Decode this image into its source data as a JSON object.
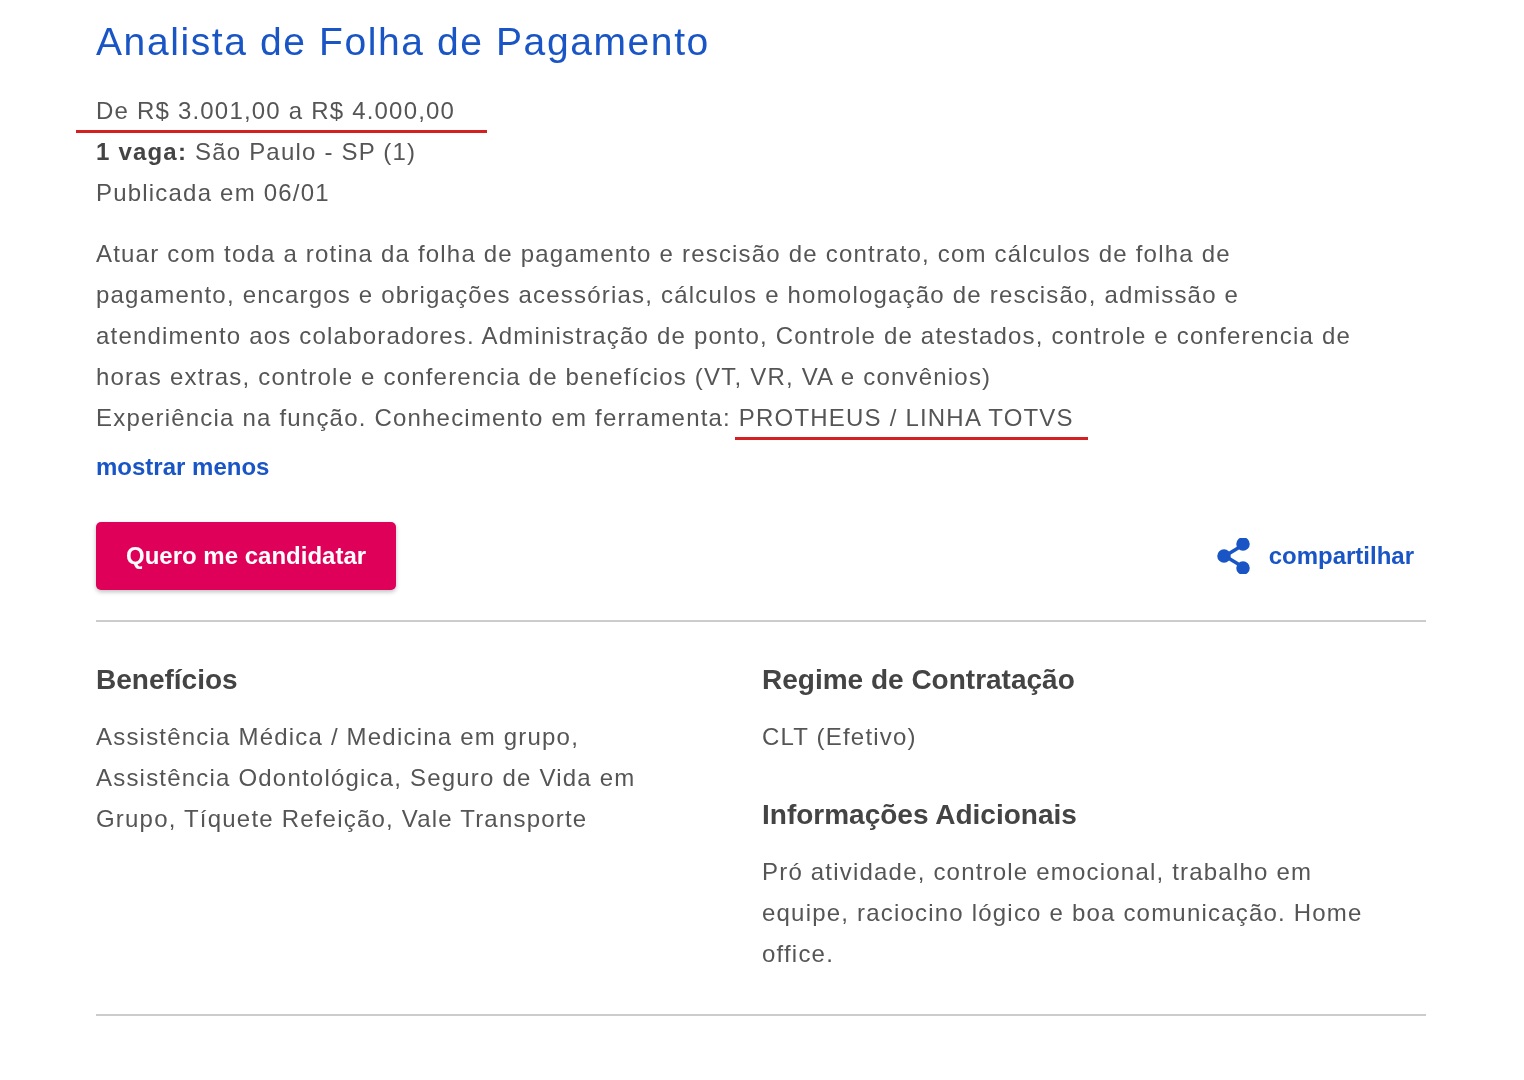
{
  "job": {
    "title": "Analista de Folha de Pagamento",
    "salary": {
      "text": "De R$ 3.001,00 a R$ 4.000,00",
      "underlined": true
    },
    "vacancy": "**1 vaga:** São Paulo - SP (1)",
    "published": "Publicada em 06/01",
    "description_lines": [
      [
        {
          "text": "Atuar com toda a rotina da folha de pagamento e rescisão de contrato, com cálculos de folha de",
          "underlined": false
        }
      ],
      [
        {
          "text": "pagamento, encargos e obrigações acessórias, cálculos e homologação de rescisão, admissão e",
          "underlined": false
        }
      ],
      [
        {
          "text": "atendimento aos colaboradores. Administração de ponto, Controle de atestados, controle e conferencia de",
          "underlined": false
        }
      ],
      [
        {
          "text": "horas extras, controle e conferencia de benefícios (VT, VR, VA e convênios)",
          "underlined": false
        }
      ],
      [
        {
          "text": "Experiência na função. Conhecimento em ferramenta: ",
          "underlined": false
        },
        {
          "text": "PROTHEUS / LINHA TOTVS",
          "underlined": true
        }
      ]
    ],
    "toggle_link": "mostrar menos",
    "apply_button": "Quero me candidatar",
    "share_link": "compartilhar"
  },
  "left_column": [
    {
      "heading": "Benefícios",
      "lines": [
        "Assistência Médica / Medicina em grupo,",
        "Assistência Odontológica, Seguro de Vida em",
        "Grupo, Tíquete Refeição, Vale Transporte"
      ]
    }
  ],
  "right_column": [
    {
      "heading": "Regime de Contratação",
      "lines": [
        "CLT (Efetivo)"
      ]
    },
    {
      "heading": "Informações Adicionais",
      "lines": [
        "Pró atividade, controle emocional, trabalho em",
        "equipe, raciocino lógico e boa comunicação. Home",
        "office."
      ]
    }
  ]
}
